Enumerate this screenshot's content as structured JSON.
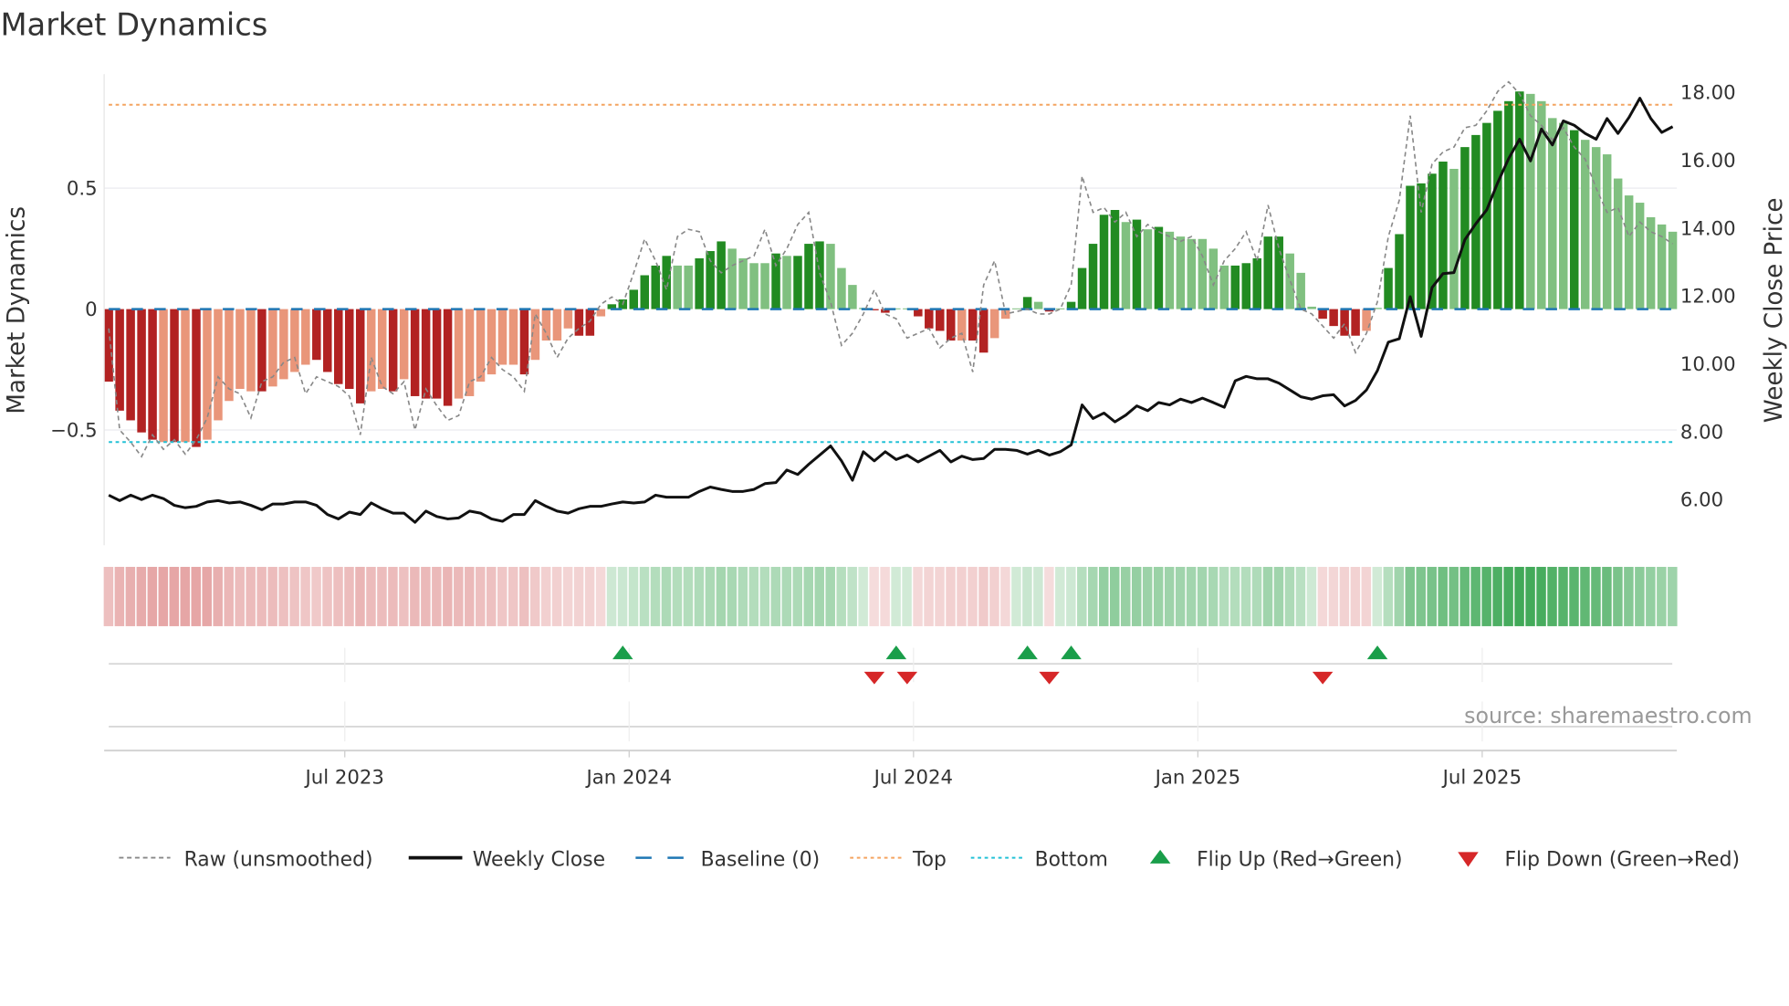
{
  "chart_data": {
    "type": "bar",
    "title": "Market Dynamics",
    "ylabel_left": "Market Dynamics",
    "ylabel_right": "Weekly Close Price",
    "left_ticks": [
      {
        "v": 0.5,
        "label": "0.5"
      },
      {
        "v": 0,
        "label": "0"
      },
      {
        "v": -0.5,
        "label": "−0.5"
      }
    ],
    "right_ticks": [
      {
        "v": 18,
        "label": "18.00"
      },
      {
        "v": 16,
        "label": "16.00"
      },
      {
        "v": 14,
        "label": "14.00"
      },
      {
        "v": 12,
        "label": "12.00"
      },
      {
        "v": 10,
        "label": "10.00"
      },
      {
        "v": 8,
        "label": "8.00"
      },
      {
        "v": 6,
        "label": "6.00"
      }
    ],
    "x_ticks": [
      {
        "week": 22,
        "label": "Jul 2023"
      },
      {
        "week": 48,
        "label": "Jan 2024"
      },
      {
        "week": 74,
        "label": "Jul 2024"
      },
      {
        "week": 100,
        "label": "Jan 2025"
      },
      {
        "week": 126,
        "label": "Jul 2025"
      }
    ],
    "top_level": 0.845,
    "bottom_level": -0.55,
    "baseline": 0,
    "values": [
      -0.3,
      -0.42,
      -0.46,
      -0.51,
      -0.54,
      -0.55,
      -0.55,
      -0.55,
      -0.57,
      -0.54,
      -0.46,
      -0.38,
      -0.33,
      -0.34,
      -0.34,
      -0.32,
      -0.29,
      -0.26,
      -0.23,
      -0.21,
      -0.26,
      -0.31,
      -0.33,
      -0.39,
      -0.34,
      -0.33,
      -0.34,
      -0.29,
      -0.36,
      -0.37,
      -0.37,
      -0.4,
      -0.37,
      -0.36,
      -0.3,
      -0.27,
      -0.23,
      -0.23,
      -0.27,
      -0.21,
      -0.13,
      -0.13,
      -0.08,
      -0.11,
      -0.11,
      -0.03,
      0.02,
      0.04,
      0.08,
      0.14,
      0.18,
      0.22,
      0.18,
      0.18,
      0.21,
      0.24,
      0.28,
      0.25,
      0.21,
      0.19,
      0.19,
      0.23,
      0.22,
      0.22,
      0.27,
      0.28,
      0.27,
      0.17,
      0.1,
      0.005,
      -0.005,
      -0.015,
      0.003,
      0.003,
      -0.03,
      -0.08,
      -0.09,
      -0.13,
      -0.13,
      -0.13,
      -0.18,
      -0.12,
      -0.04,
      0.003,
      0.05,
      0.03,
      -0.01,
      0.003,
      0.03,
      0.17,
      0.27,
      0.39,
      0.41,
      0.36,
      0.37,
      0.33,
      0.34,
      0.32,
      0.3,
      0.29,
      0.29,
      0.25,
      0.18,
      0.18,
      0.19,
      0.21,
      0.3,
      0.3,
      0.23,
      0.15,
      0.01,
      -0.04,
      -0.07,
      -0.11,
      -0.11,
      -0.09,
      0.005,
      0.17,
      0.31,
      0.51,
      0.52,
      0.56,
      0.61,
      0.58,
      0.67,
      0.72,
      0.77,
      0.82,
      0.86,
      0.9,
      0.89,
      0.86,
      0.79,
      0.77,
      0.74,
      0.7,
      0.67,
      0.64,
      0.54,
      0.47,
      0.44,
      0.38,
      0.35,
      0.32
    ],
    "shade": "DDDDDLDLDLLLLLDLLLLDDDDDLLDLDDDDLLLLLLDLLLLDDLDDDDDDLLDDDLLLLDLDDDLLLLDDLLDDDDLDDLLLDLDLDDDDDLDLDLLLLLLDDDDDLLLDDDDLLDDDDDDLDDDDDDLLLLDLLLLLLLLL",
    "raw": [
      -0.08,
      -0.5,
      -0.55,
      -0.61,
      -0.52,
      -0.58,
      -0.54,
      -0.6,
      -0.54,
      -0.45,
      -0.28,
      -0.33,
      -0.35,
      -0.45,
      -0.3,
      -0.28,
      -0.22,
      -0.2,
      -0.35,
      -0.28,
      -0.3,
      -0.32,
      -0.36,
      -0.52,
      -0.2,
      -0.32,
      -0.35,
      -0.3,
      -0.5,
      -0.33,
      -0.4,
      -0.46,
      -0.44,
      -0.3,
      -0.28,
      -0.2,
      -0.25,
      -0.28,
      -0.34,
      -0.02,
      -0.1,
      -0.2,
      -0.12,
      -0.08,
      -0.05,
      0.02,
      0.05,
      0.02,
      0.15,
      0.29,
      0.2,
      0.08,
      0.3,
      0.33,
      0.32,
      0.2,
      0.15,
      0.18,
      0.2,
      0.22,
      0.33,
      0.18,
      0.25,
      0.35,
      0.4,
      0.15,
      0.03,
      -0.15,
      -0.1,
      -0.02,
      0.08,
      -0.02,
      -0.04,
      -0.12,
      -0.1,
      -0.08,
      -0.16,
      -0.12,
      -0.1,
      -0.26,
      0.1,
      0.2,
      -0.02,
      -0.01,
      0.0,
      -0.02,
      -0.02,
      0.0,
      0.1,
      0.55,
      0.4,
      0.42,
      0.36,
      0.4,
      0.3,
      0.35,
      0.32,
      0.3,
      0.28,
      0.3,
      0.22,
      0.1,
      0.2,
      0.25,
      0.32,
      0.2,
      0.43,
      0.25,
      0.12,
      0.0,
      -0.02,
      -0.07,
      -0.12,
      -0.06,
      -0.18,
      -0.1,
      0.03,
      0.3,
      0.45,
      0.8,
      0.4,
      0.6,
      0.65,
      0.67,
      0.75,
      0.76,
      0.82,
      0.9,
      0.94,
      0.89,
      0.8,
      0.76,
      0.7,
      0.75,
      0.67,
      0.62,
      0.5,
      0.4,
      0.42,
      0.3,
      0.36,
      0.32,
      0.3,
      0.27
    ],
    "price": [
      6.13,
      5.97,
      6.13,
      6.0,
      6.13,
      6.03,
      5.83,
      5.76,
      5.8,
      5.93,
      5.97,
      5.9,
      5.93,
      5.83,
      5.7,
      5.87,
      5.87,
      5.93,
      5.93,
      5.83,
      5.56,
      5.43,
      5.63,
      5.56,
      5.9,
      5.73,
      5.6,
      5.6,
      5.33,
      5.66,
      5.5,
      5.43,
      5.46,
      5.66,
      5.6,
      5.43,
      5.36,
      5.56,
      5.56,
      5.97,
      5.8,
      5.66,
      5.6,
      5.73,
      5.8,
      5.8,
      5.87,
      5.93,
      5.9,
      5.93,
      6.13,
      6.07,
      6.07,
      6.07,
      6.24,
      6.37,
      6.3,
      6.24,
      6.24,
      6.3,
      6.47,
      6.5,
      6.87,
      6.74,
      7.04,
      7.31,
      7.58,
      7.14,
      6.57,
      7.41,
      7.14,
      7.41,
      7.18,
      7.31,
      7.11,
      7.28,
      7.45,
      7.11,
      7.28,
      7.18,
      7.21,
      7.48,
      7.48,
      7.45,
      7.34,
      7.45,
      7.31,
      7.41,
      7.61,
      8.79,
      8.39,
      8.55,
      8.29,
      8.49,
      8.76,
      8.62,
      8.86,
      8.79,
      8.96,
      8.86,
      8.99,
      8.86,
      8.72,
      9.5,
      9.63,
      9.56,
      9.56,
      9.43,
      9.23,
      9.03,
      8.96,
      9.06,
      9.09,
      8.76,
      8.92,
      9.23,
      9.8,
      10.64,
      10.74,
      11.98,
      10.81,
      12.25,
      12.66,
      12.69,
      13.66,
      14.13,
      14.54,
      15.34,
      16.05,
      16.62,
      15.98,
      16.92,
      16.45,
      17.16,
      17.03,
      16.79,
      16.62,
      17.23,
      16.79,
      17.26,
      17.83,
      17.23,
      16.82,
      16.99
    ],
    "flip_up_weeks": [
      47,
      72,
      84,
      88,
      116
    ],
    "flip_down_weeks": [
      70,
      73,
      86,
      111
    ],
    "legend": {
      "placement": "bottom",
      "items": [
        "Raw (unsmoothed)",
        "Weekly Close",
        "Baseline (0)",
        "Top",
        "Bottom",
        "Flip Up (Red→Green)",
        "Flip Down (Green→Red)"
      ]
    },
    "source": "source: sharemaestro.com",
    "colors": {
      "red_dark": "#b22222",
      "red_light": "#e9967a",
      "green_dark": "#228b22",
      "green_light": "#80c080",
      "top": "#f4a460",
      "bottom": "#22c1d6",
      "baseline": "#1f77b4",
      "raw": "#888888",
      "close": "#111111",
      "flip_up": "#1a9e4a",
      "flip_down": "#d62728"
    }
  }
}
